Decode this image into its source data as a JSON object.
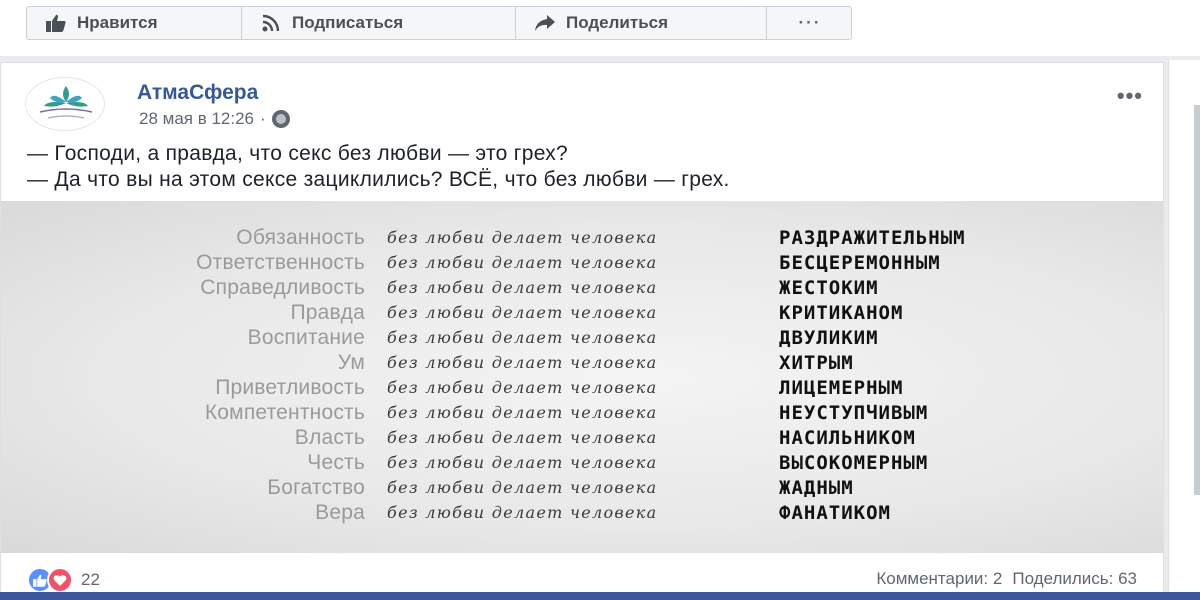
{
  "top_actions": {
    "like_label": "Нравится",
    "follow_label": "Подписаться",
    "share_label": "Поделиться",
    "more_label": "···"
  },
  "post": {
    "page_name": "АтмаСфера",
    "timestamp": "28 мая в 12:26",
    "meta_separator": "·",
    "more_label": "•••",
    "text_lines": [
      "— Господи, а правда, что секс без любви — это грех?",
      "— Да что вы на этом сексе зациклились? ВСЁ, что без любви — грех."
    ],
    "image": {
      "phrase": "без любви делает человека",
      "rows": [
        {
          "word": "Обязанность",
          "result": "РАЗДРАЖИТЕЛЬНЫМ"
        },
        {
          "word": "Ответственность",
          "result": "БЕСЦЕРЕМОННЫМ"
        },
        {
          "word": "Справедливость",
          "result": "ЖЕСТОКИМ"
        },
        {
          "word": "Правда",
          "result": "КРИТИКАНОМ"
        },
        {
          "word": "Воспитание",
          "result": "ДВУЛИКИМ"
        },
        {
          "word": "Ум",
          "result": "ХИТРЫМ"
        },
        {
          "word": "Приветливость",
          "result": "ЛИЦЕМЕРНЫМ"
        },
        {
          "word": "Компетентность",
          "result": "НЕУСТУПЧИВЫМ"
        },
        {
          "word": "Власть",
          "result": "НАСИЛЬНИКОМ"
        },
        {
          "word": "Честь",
          "result": "ВЫСОКОМЕРНЫМ"
        },
        {
          "word": "Богатство",
          "result": "ЖАДНЫМ"
        },
        {
          "word": "Вера",
          "result": "ФАНАТИКОМ"
        }
      ]
    },
    "reactions_count": "22",
    "comments": "Комментарии: 2",
    "shares": "Поделились: 63"
  },
  "colors": {
    "link": "#365899",
    "like_reaction": "#5890ff",
    "love_reaction": "#f25268",
    "meta_text": "#616770"
  },
  "icons": [
    "thumbs-up-icon",
    "rss-icon",
    "share-arrow-icon",
    "globe-icon",
    "like-reaction-icon",
    "love-reaction-icon"
  ]
}
